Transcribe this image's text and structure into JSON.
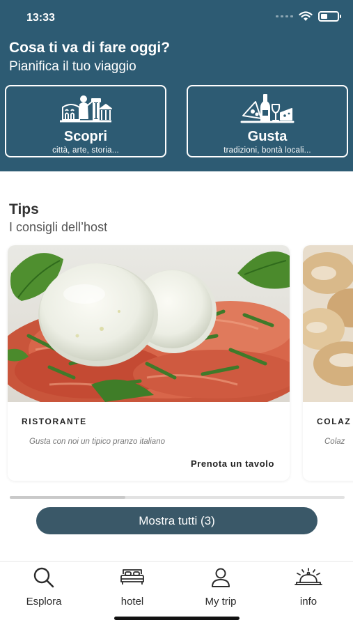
{
  "status_bar": {
    "time": "13:33",
    "icons": [
      "signal-icon",
      "wifi-icon",
      "battery-icon"
    ]
  },
  "header": {
    "title": "Cosa ti va di fare oggi?",
    "subtitle": "Pianifica il tuo viaggio",
    "background_color": "#2d5b73"
  },
  "categories": [
    {
      "label": "Scopri",
      "subtitle": "città, arte, storia...",
      "icon": "monuments-icon"
    },
    {
      "label": "Gusta",
      "subtitle": "tradizioni, bontà locali...",
      "icon": "food-wine-icon"
    }
  ],
  "tips": {
    "title": "Tips",
    "subtitle": "I consigli dell’host",
    "cards": [
      {
        "category": "RISTORANTE",
        "description": "Gusta con noi un tipico pranzo italiano",
        "action": "Prenota un tavolo",
        "image": "caprese-salad-photo"
      },
      {
        "category": "COLAZ",
        "description": "Colaz",
        "action": "",
        "image": "pastries-photo"
      }
    ],
    "show_all_label": "Mostra tutti (3)",
    "button_color": "#3a5868"
  },
  "tabbar": {
    "items": [
      {
        "label": "Esplora",
        "icon": "search-icon"
      },
      {
        "label": "hotel",
        "icon": "hotel-bed-icon"
      },
      {
        "label": "My trip",
        "icon": "user-icon"
      },
      {
        "label": "info",
        "icon": "reception-bell-icon"
      }
    ]
  }
}
